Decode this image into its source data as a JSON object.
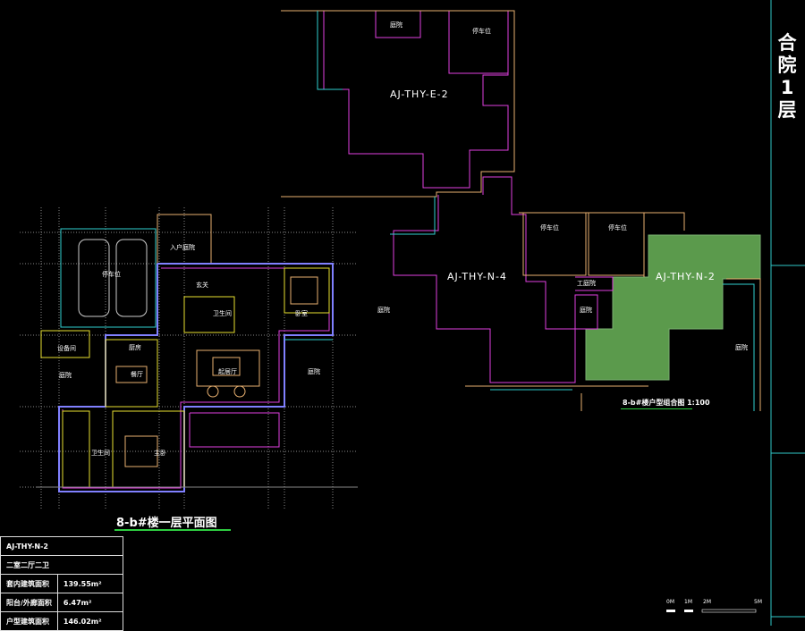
{
  "side_title": "合院1层",
  "plan_title": "8-b#楼一层平面图",
  "combo_title": "8-b#楼户型组合图 1:100",
  "units": {
    "e2": "AJ-THY-E-2",
    "n4": "AJ-THY-N-4",
    "n2": "AJ-THY-N-2"
  },
  "rooms": {
    "top_yard": "庭院",
    "top_parking": "停车位",
    "court_left": "庭院",
    "right_parking_1": "停车位",
    "right_parking_2": "停车位",
    "right_yard_small": "工庭院",
    "right_yard": "庭院",
    "right_court": "庭院",
    "entrance_court": "入户庭院",
    "garage": "停车位",
    "foyer": "玄关",
    "bath": "卫生间",
    "bedroom": "卧室",
    "equipment": "设备间",
    "kitchen": "厨房",
    "dining": "餐厅",
    "living": "起居厅",
    "yard_w": "庭院",
    "yard_e": "庭院",
    "master_bath": "卫生间",
    "master_bed": "主卧"
  },
  "area_table": {
    "unit": "AJ-THY-N-2",
    "layout": "二室二厅二卫",
    "rows": [
      {
        "label": "套内建筑面积",
        "value": "139.55m²"
      },
      {
        "label": "阳台/外廊面积",
        "value": "6.47m²"
      },
      {
        "label": "户型建筑面积",
        "value": "146.02m²"
      }
    ]
  },
  "scale_bar": [
    "0M",
    "1M",
    "2M",
    "5M"
  ],
  "colors": {
    "background": "#000000",
    "unit_fill": "#5b9a4c",
    "magenta": "#e040e0",
    "orange": "#e8b070",
    "cyan": "#30d0d0",
    "purple": "#7070ff",
    "yellow": "#e8e030",
    "title_underline": "#2ecc40"
  }
}
